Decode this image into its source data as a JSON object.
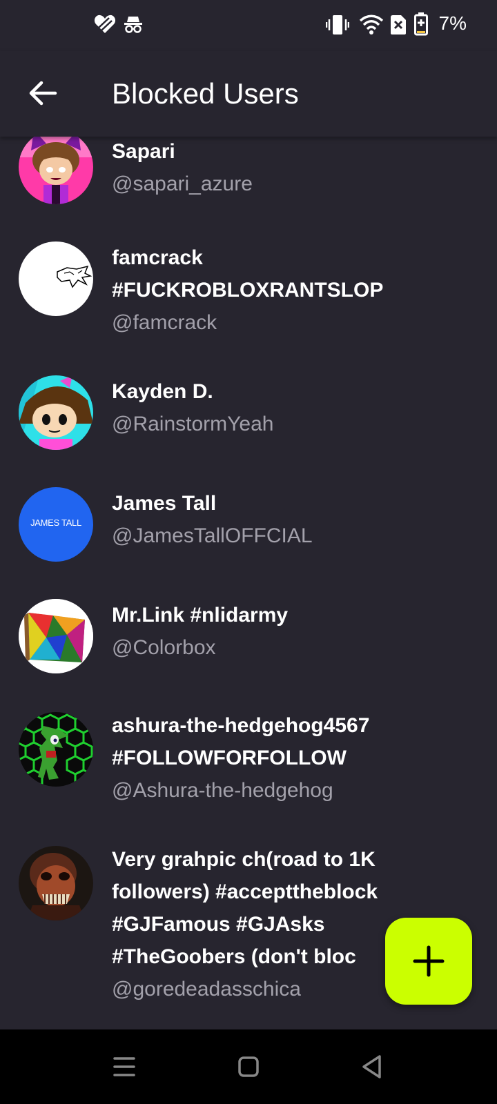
{
  "status_bar": {
    "battery_percent": "7%",
    "icons": [
      "heart-app-icon",
      "incognito-icon",
      "vibrate-icon",
      "wifi-icon",
      "no-sim-icon",
      "battery-icon"
    ]
  },
  "header": {
    "title": "Blocked Users",
    "back_icon": "arrow-left-icon"
  },
  "users": [
    {
      "name": "Sapari",
      "handle": "@sapari_azure"
    },
    {
      "name": "famcrack #FUCKROBLOXRANTSLOP",
      "handle": "@famcrack"
    },
    {
      "name": "Kayden D.",
      "handle": "@RainstormYeah"
    },
    {
      "name": "James Tall",
      "handle": "@JamesTallOFFCIAL",
      "avatar_text": "JAMES TALL"
    },
    {
      "name": "Mr.Link #nlidarmy",
      "handle": "@Colorbox"
    },
    {
      "name": "ashura-the-hedgehog4567 #FOLLOWFORFOLLOW",
      "handle": "@Ashura-the-hedgehog"
    },
    {
      "name": "Very grahpic ch(road to 1K followers) #accepttheblock #GJFamous #GJAsks #TheGoobers (don't bloc",
      "handle": "@goredeadasschica"
    }
  ],
  "fab": {
    "icon": "plus-icon",
    "color": "#cbff00"
  },
  "nav_bar": {
    "icons": [
      "menu-icon",
      "home-icon",
      "back-triangle-icon"
    ]
  },
  "colors": {
    "background": "#27252f",
    "text_primary": "#ffffff",
    "text_secondary": "#a3a1ab",
    "accent": "#cbff00"
  }
}
